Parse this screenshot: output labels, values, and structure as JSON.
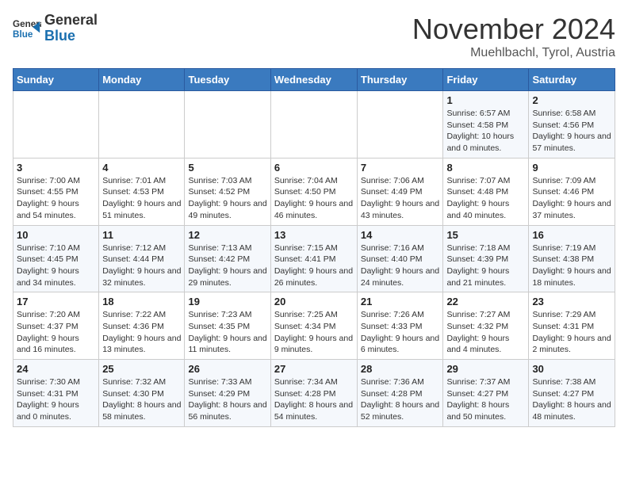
{
  "header": {
    "logo": {
      "general": "General",
      "blue": "Blue"
    },
    "title": "November 2024",
    "location": "Muehlbachl, Tyrol, Austria"
  },
  "weekdays": [
    "Sunday",
    "Monday",
    "Tuesday",
    "Wednesday",
    "Thursday",
    "Friday",
    "Saturday"
  ],
  "weeks": [
    [
      null,
      null,
      null,
      null,
      null,
      {
        "day": "1",
        "sunrise": "Sunrise: 6:57 AM",
        "sunset": "Sunset: 4:58 PM",
        "daylight": "Daylight: 10 hours and 0 minutes."
      },
      {
        "day": "2",
        "sunrise": "Sunrise: 6:58 AM",
        "sunset": "Sunset: 4:56 PM",
        "daylight": "Daylight: 9 hours and 57 minutes."
      }
    ],
    [
      {
        "day": "3",
        "sunrise": "Sunrise: 7:00 AM",
        "sunset": "Sunset: 4:55 PM",
        "daylight": "Daylight: 9 hours and 54 minutes."
      },
      {
        "day": "4",
        "sunrise": "Sunrise: 7:01 AM",
        "sunset": "Sunset: 4:53 PM",
        "daylight": "Daylight: 9 hours and 51 minutes."
      },
      {
        "day": "5",
        "sunrise": "Sunrise: 7:03 AM",
        "sunset": "Sunset: 4:52 PM",
        "daylight": "Daylight: 9 hours and 49 minutes."
      },
      {
        "day": "6",
        "sunrise": "Sunrise: 7:04 AM",
        "sunset": "Sunset: 4:50 PM",
        "daylight": "Daylight: 9 hours and 46 minutes."
      },
      {
        "day": "7",
        "sunrise": "Sunrise: 7:06 AM",
        "sunset": "Sunset: 4:49 PM",
        "daylight": "Daylight: 9 hours and 43 minutes."
      },
      {
        "day": "8",
        "sunrise": "Sunrise: 7:07 AM",
        "sunset": "Sunset: 4:48 PM",
        "daylight": "Daylight: 9 hours and 40 minutes."
      },
      {
        "day": "9",
        "sunrise": "Sunrise: 7:09 AM",
        "sunset": "Sunset: 4:46 PM",
        "daylight": "Daylight: 9 hours and 37 minutes."
      }
    ],
    [
      {
        "day": "10",
        "sunrise": "Sunrise: 7:10 AM",
        "sunset": "Sunset: 4:45 PM",
        "daylight": "Daylight: 9 hours and 34 minutes."
      },
      {
        "day": "11",
        "sunrise": "Sunrise: 7:12 AM",
        "sunset": "Sunset: 4:44 PM",
        "daylight": "Daylight: 9 hours and 32 minutes."
      },
      {
        "day": "12",
        "sunrise": "Sunrise: 7:13 AM",
        "sunset": "Sunset: 4:42 PM",
        "daylight": "Daylight: 9 hours and 29 minutes."
      },
      {
        "day": "13",
        "sunrise": "Sunrise: 7:15 AM",
        "sunset": "Sunset: 4:41 PM",
        "daylight": "Daylight: 9 hours and 26 minutes."
      },
      {
        "day": "14",
        "sunrise": "Sunrise: 7:16 AM",
        "sunset": "Sunset: 4:40 PM",
        "daylight": "Daylight: 9 hours and 24 minutes."
      },
      {
        "day": "15",
        "sunrise": "Sunrise: 7:18 AM",
        "sunset": "Sunset: 4:39 PM",
        "daylight": "Daylight: 9 hours and 21 minutes."
      },
      {
        "day": "16",
        "sunrise": "Sunrise: 7:19 AM",
        "sunset": "Sunset: 4:38 PM",
        "daylight": "Daylight: 9 hours and 18 minutes."
      }
    ],
    [
      {
        "day": "17",
        "sunrise": "Sunrise: 7:20 AM",
        "sunset": "Sunset: 4:37 PM",
        "daylight": "Daylight: 9 hours and 16 minutes."
      },
      {
        "day": "18",
        "sunrise": "Sunrise: 7:22 AM",
        "sunset": "Sunset: 4:36 PM",
        "daylight": "Daylight: 9 hours and 13 minutes."
      },
      {
        "day": "19",
        "sunrise": "Sunrise: 7:23 AM",
        "sunset": "Sunset: 4:35 PM",
        "daylight": "Daylight: 9 hours and 11 minutes."
      },
      {
        "day": "20",
        "sunrise": "Sunrise: 7:25 AM",
        "sunset": "Sunset: 4:34 PM",
        "daylight": "Daylight: 9 hours and 9 minutes."
      },
      {
        "day": "21",
        "sunrise": "Sunrise: 7:26 AM",
        "sunset": "Sunset: 4:33 PM",
        "daylight": "Daylight: 9 hours and 6 minutes."
      },
      {
        "day": "22",
        "sunrise": "Sunrise: 7:27 AM",
        "sunset": "Sunset: 4:32 PM",
        "daylight": "Daylight: 9 hours and 4 minutes."
      },
      {
        "day": "23",
        "sunrise": "Sunrise: 7:29 AM",
        "sunset": "Sunset: 4:31 PM",
        "daylight": "Daylight: 9 hours and 2 minutes."
      }
    ],
    [
      {
        "day": "24",
        "sunrise": "Sunrise: 7:30 AM",
        "sunset": "Sunset: 4:31 PM",
        "daylight": "Daylight: 9 hours and 0 minutes."
      },
      {
        "day": "25",
        "sunrise": "Sunrise: 7:32 AM",
        "sunset": "Sunset: 4:30 PM",
        "daylight": "Daylight: 8 hours and 58 minutes."
      },
      {
        "day": "26",
        "sunrise": "Sunrise: 7:33 AM",
        "sunset": "Sunset: 4:29 PM",
        "daylight": "Daylight: 8 hours and 56 minutes."
      },
      {
        "day": "27",
        "sunrise": "Sunrise: 7:34 AM",
        "sunset": "Sunset: 4:28 PM",
        "daylight": "Daylight: 8 hours and 54 minutes."
      },
      {
        "day": "28",
        "sunrise": "Sunrise: 7:36 AM",
        "sunset": "Sunset: 4:28 PM",
        "daylight": "Daylight: 8 hours and 52 minutes."
      },
      {
        "day": "29",
        "sunrise": "Sunrise: 7:37 AM",
        "sunset": "Sunset: 4:27 PM",
        "daylight": "Daylight: 8 hours and 50 minutes."
      },
      {
        "day": "30",
        "sunrise": "Sunrise: 7:38 AM",
        "sunset": "Sunset: 4:27 PM",
        "daylight": "Daylight: 8 hours and 48 minutes."
      }
    ]
  ]
}
